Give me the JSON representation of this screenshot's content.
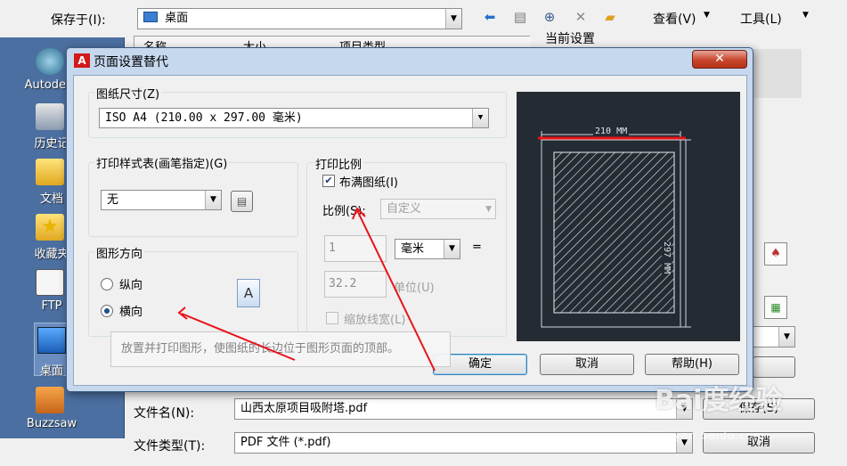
{
  "save_dialog": {
    "save_in_label": "保存于(I):",
    "save_in_value": "桌面",
    "view_menu": "查看(V)",
    "tools_menu": "工具(L)",
    "current_settings": "当前设置",
    "columns": [
      "名称",
      "大小",
      "项目类型"
    ],
    "places": [
      {
        "label": "Autodesk",
        "icon": "autodesk-icon"
      },
      {
        "label": "历史记",
        "icon": "history-icon"
      },
      {
        "label": "文档",
        "icon": "documents-folder-icon"
      },
      {
        "label": "收藏夹",
        "icon": "favorites-folder-icon"
      },
      {
        "label": "FTP",
        "icon": "ftp-icon"
      },
      {
        "label": "桌面",
        "icon": "desktop-icon"
      },
      {
        "label": "Buzzsaw",
        "icon": "buzzsaw-icon"
      }
    ],
    "filename_label": "文件名(N):",
    "filename_value": "山西太原项目吸附塔.pdf",
    "filetype_label": "文件类型(T):",
    "filetype_value": "PDF 文件 (*.pdf)",
    "save_button": "保存(S)",
    "cancel_button": "取消"
  },
  "dialog": {
    "title": "页面设置替代",
    "close": "✕",
    "paper_size_group": "图纸尺寸(Z)",
    "paper_size_value": "ISO A4 (210.00 x 297.00 毫米)",
    "plot_style_group": "打印样式表(画笔指定)(G)",
    "plot_style_value": "无",
    "orientation_group": "图形方向",
    "portrait_label": "纵向",
    "landscape_label": "横向",
    "orientation_icon_letter": "A",
    "scale_group": "打印比例",
    "fit_to_paper_label": "布满图纸(I)",
    "scale_label": "比例(S):",
    "scale_value": "自定义",
    "scale_num": "1",
    "unit_value": "毫米",
    "equals": "=",
    "scale_den": "32.2",
    "unit_label": "单位(U)",
    "lineweight_label": "缩放线宽(L)",
    "preview_width": "210 MM",
    "preview_height": "297 MM",
    "ok_button": "确定",
    "cancel_button": "取消",
    "help_button": "帮助(H)",
    "tooltip": "放置并打印图形，使图纸的长边位于图形页面的顶部。"
  },
  "watermark": {
    "text": "Bai度经验",
    "url": "jingyan.baidu.com"
  },
  "colors": {
    "accent_red": "#e8131a",
    "title_bar": "#c6d8ee",
    "preview_bg": "#252b33"
  }
}
